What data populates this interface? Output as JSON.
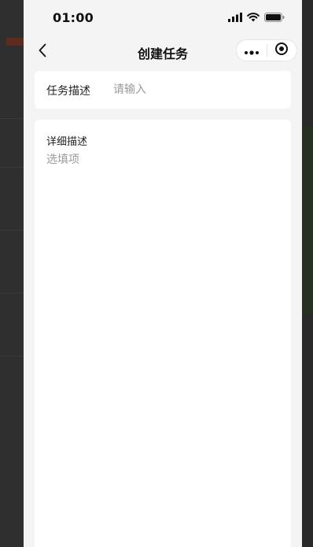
{
  "status_bar": {
    "time": "01:00",
    "icons": [
      "signal-icon",
      "wifi-icon",
      "battery-icon"
    ]
  },
  "nav": {
    "title": "创建任务",
    "back_icon": "chevron-left-icon",
    "capsule": [
      "more-icon",
      "close-target-icon"
    ]
  },
  "form": {
    "task_desc": {
      "label": "任务描述",
      "value": "",
      "placeholder": "请输入"
    },
    "detail_desc": {
      "label": "详细描述",
      "value": "",
      "placeholder": "选填项"
    }
  }
}
